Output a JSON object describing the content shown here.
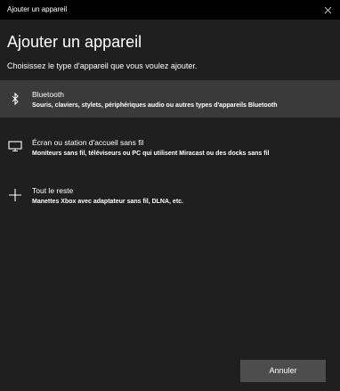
{
  "window": {
    "title": "Ajouter un appareil",
    "close_icon": "close-icon"
  },
  "dialog": {
    "heading": "Ajouter un appareil",
    "subtitle": "Choisissez le type d'appareil que vous voulez ajouter."
  },
  "options": [
    {
      "icon": "bluetooth-icon",
      "name": "Bluetooth",
      "description": "Souris, claviers, stylets, périphériques audio ou autres types d'appareils Bluetooth",
      "selected": true
    },
    {
      "icon": "monitor-icon",
      "name": "Écran ou station d'accueil sans fil",
      "description": "Moniteurs sans fil, téléviseurs ou PC qui utilisent Miracast ou des docks sans fil",
      "selected": false
    },
    {
      "icon": "plus-icon",
      "name": "Tout le reste",
      "description": "Manettes Xbox avec adaptateur sans fil, DLNA, etc.",
      "selected": false
    }
  ],
  "footer": {
    "cancel_label": "Annuler"
  },
  "colors": {
    "background": "#1f1f1f",
    "titlebar": "#000000",
    "selected_row": "#3a3a3a",
    "button": "#4d4d4d",
    "text": "#ffffff"
  }
}
